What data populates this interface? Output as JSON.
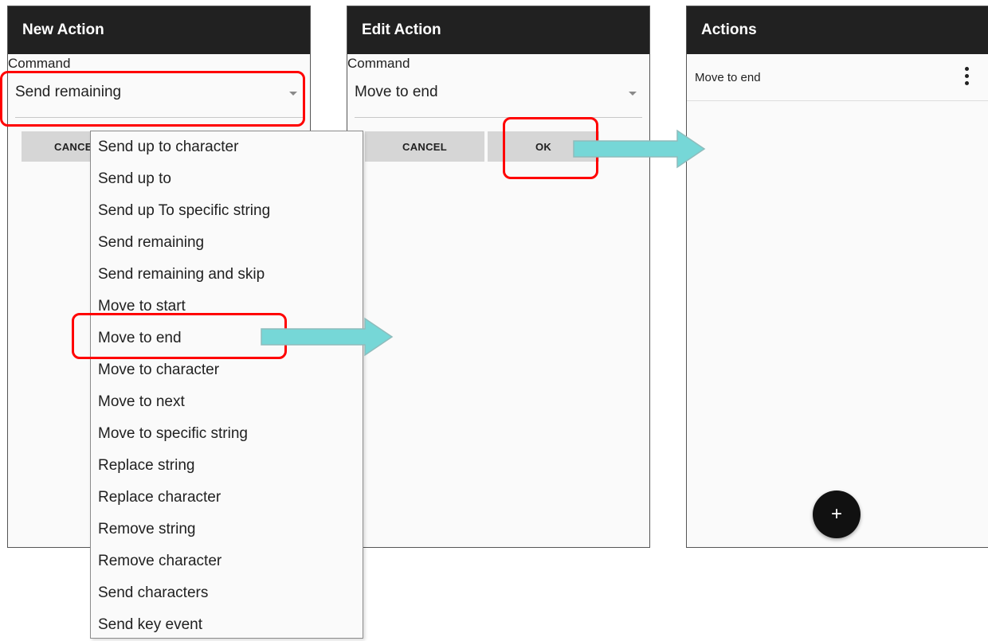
{
  "screen_new_action": {
    "title": "New Action",
    "command_label": "Command",
    "command_value": "Send remaining",
    "cancel_label": "CANCEL"
  },
  "command_dropdown": {
    "options": [
      "Send up to character",
      "Send up to",
      "Send up To specific string",
      "Send remaining",
      "Send remaining and skip",
      "Move to start",
      "Move to end",
      "Move to character",
      "Move to next",
      "Move to specific string",
      "Replace string",
      "Replace character",
      "Remove string",
      "Remove character",
      "Send characters",
      "Send key event"
    ]
  },
  "screen_edit_action": {
    "title": "Edit Action",
    "command_label": "Command",
    "command_value": "Move to end",
    "cancel_label": "CANCEL",
    "ok_label": "OK"
  },
  "screen_actions": {
    "title": "Actions",
    "items": [
      {
        "label": "Move to end"
      }
    ],
    "fab_label": "+"
  },
  "colors": {
    "titlebar": "#212121",
    "highlight": "#ff0000",
    "arrow": "#76d7d7",
    "button": "#d6d6d6"
  }
}
